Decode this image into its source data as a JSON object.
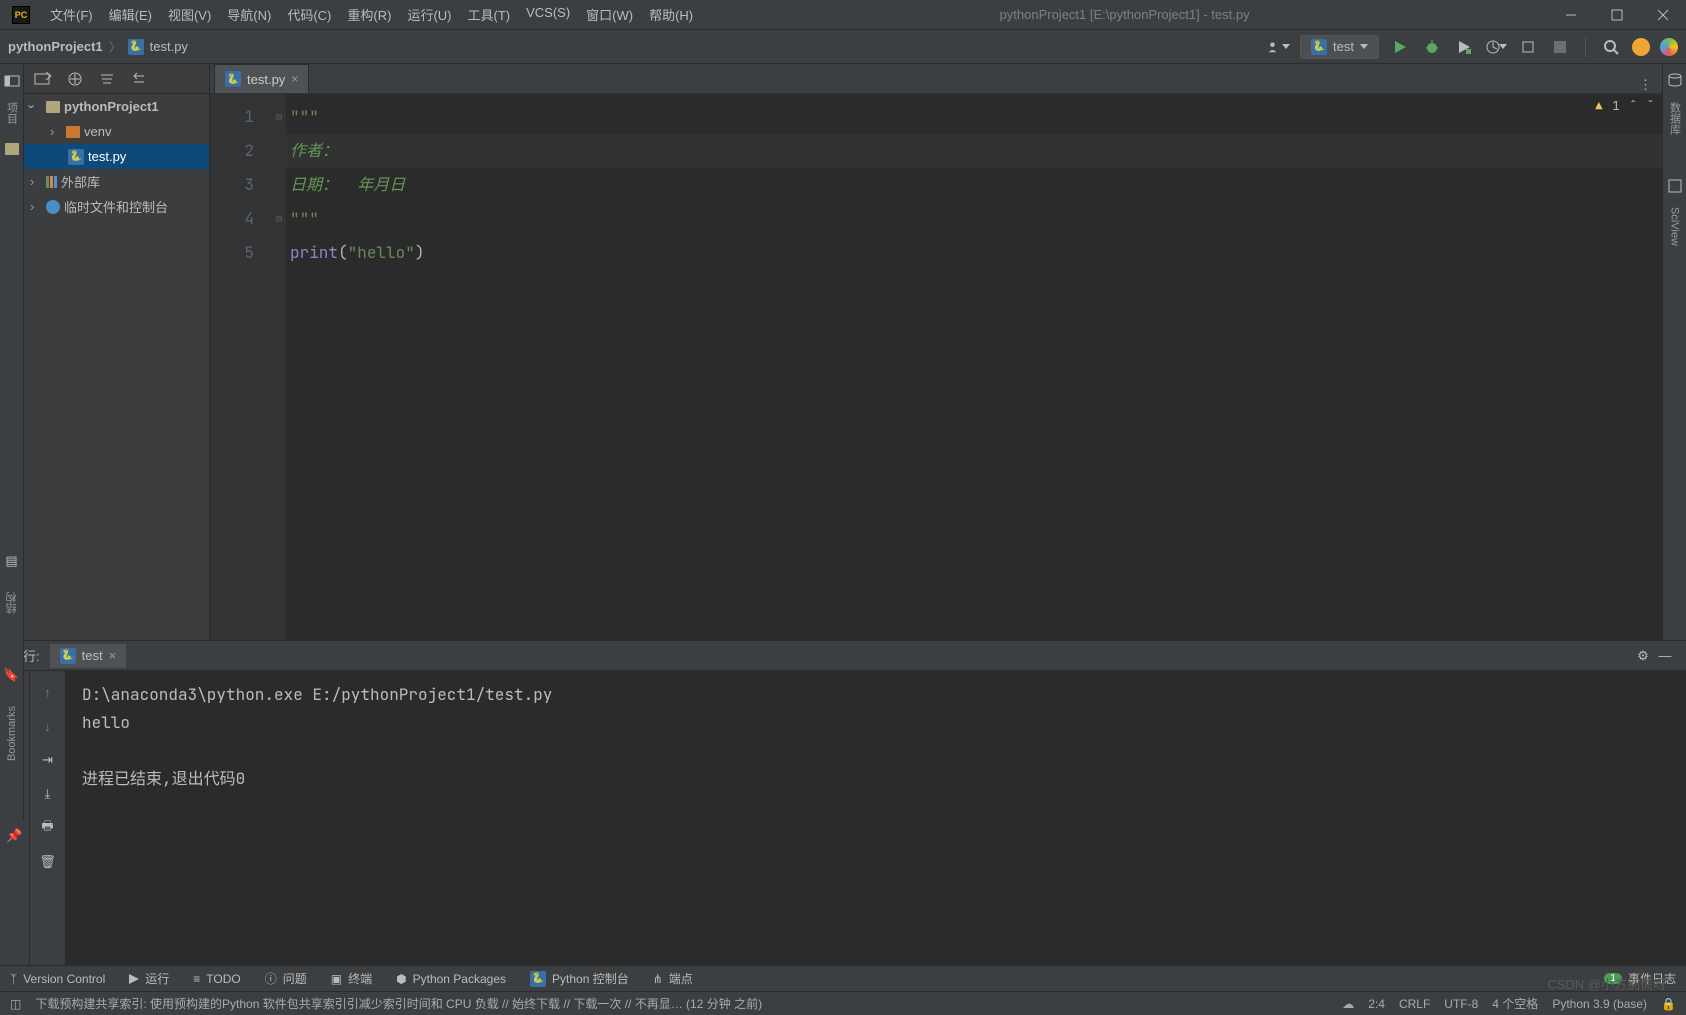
{
  "window": {
    "title": "pythonProject1 [E:\\pythonProject1] - test.py"
  },
  "menu": {
    "file": "文件(F)",
    "edit": "编辑(E)",
    "view": "视图(V)",
    "navigate": "导航(N)",
    "code": "代码(C)",
    "refactor": "重构(R)",
    "run": "运行(U)",
    "tools": "工具(T)",
    "vcs": "VCS(S)",
    "window": "窗口(W)",
    "help": "帮助(H)"
  },
  "breadcrumb": {
    "project": "pythonProject1",
    "file": "test.py"
  },
  "run_config": {
    "name": "test"
  },
  "project_tree": {
    "root": "pythonProject1",
    "venv": "venv",
    "file": "test.py",
    "ext_lib": "外部库",
    "scratch": "临时文件和控制台"
  },
  "editor": {
    "tab": "test.py",
    "warning_count": "1",
    "lines": {
      "l1": "\"\"\"",
      "l2": "作者：",
      "l3_a": "日期：",
      "l3_b": "  年月日",
      "l4": "\"\"\"",
      "l5_fn": "print",
      "l5_po": "(",
      "l5_str": "\"hello\"",
      "l5_pc": ")"
    },
    "line_numbers": [
      "1",
      "2",
      "3",
      "4",
      "5"
    ]
  },
  "run": {
    "label": "运行:",
    "tab": "test",
    "console": {
      "cmd": "D:\\anaconda3\\python.exe E:/pythonProject1/test.py",
      "out": "hello",
      "exit": "进程已结束,退出代码0"
    }
  },
  "left_strip": {
    "project": "项目",
    "structure": "结构",
    "bookmarks": "Bookmarks"
  },
  "right_strip": {
    "database": "数据库",
    "sciview": "SciView"
  },
  "bottom_tabs": {
    "vcs": "Version Control",
    "run": "运行",
    "todo": "TODO",
    "problems": "问题",
    "terminal": "终端",
    "pypkg": "Python Packages",
    "pyconsole": "Python 控制台",
    "endpoints": "端点",
    "eventlog": "事件日志",
    "badge": "1"
  },
  "status": {
    "msg": "下载预构建共享索引: 使用预构建的Python 软件包共享索引引减少索引时间和 CPU 负载 // 始终下载 // 下载一次 // 不再显… (12 分钟 之前)",
    "pos": "2:4",
    "crlf": "CRLF",
    "enc": "UTF-8",
    "indent": "4 个空格",
    "python": "Python 3.9 (base)"
  },
  "watermark": "CSDN @小方别慌呀"
}
